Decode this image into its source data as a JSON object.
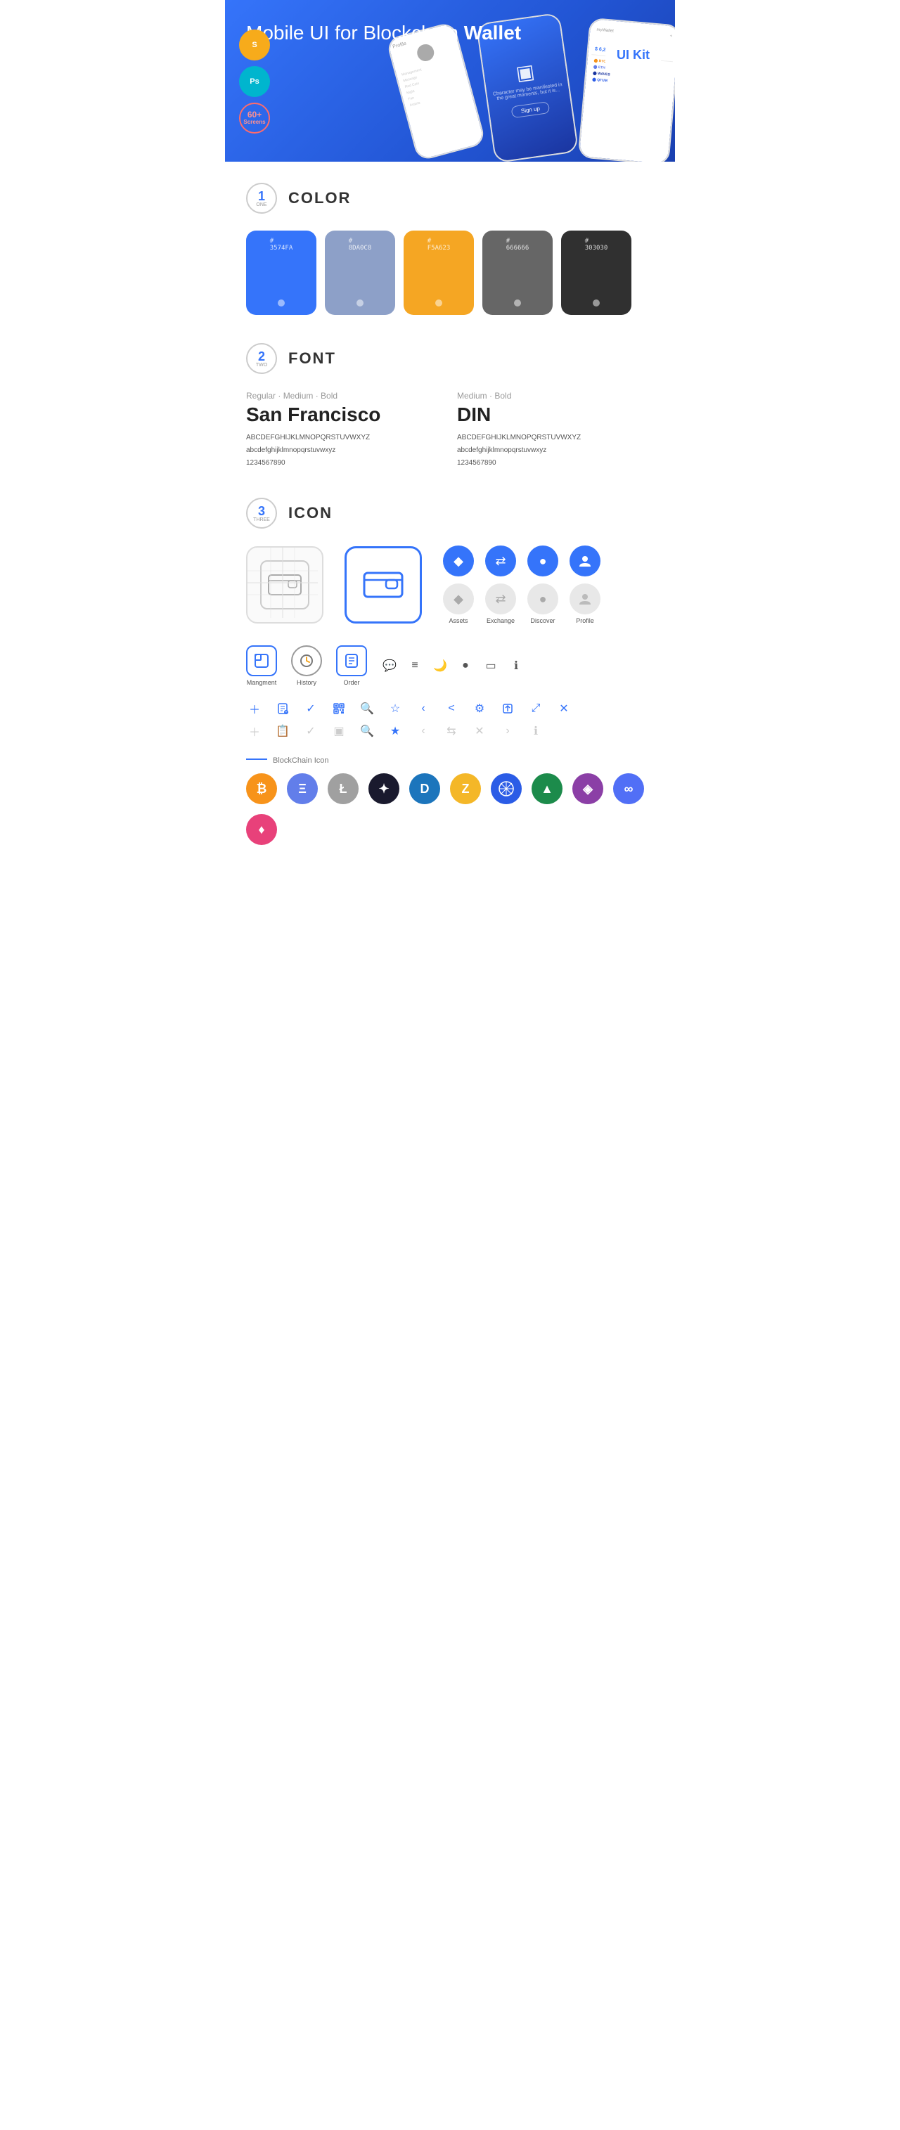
{
  "hero": {
    "title_normal": "Mobile UI for Blockchain ",
    "title_bold": "Wallet",
    "badge": "UI Kit",
    "tools": [
      {
        "name": "Sketch",
        "symbol": "S",
        "color": "#F7AB1B"
      },
      {
        "name": "Photoshop",
        "symbol": "Ps",
        "color": "#00B5CE"
      }
    ],
    "screens_badge": {
      "count": "60+",
      "label": "Screens"
    }
  },
  "sections": {
    "color": {
      "number": "1",
      "word": "ONE",
      "title": "COLOR",
      "swatches": [
        {
          "hex": "#3574FA",
          "label": "3574FA",
          "bg": "#3574FA"
        },
        {
          "hex": "#8DA0C8",
          "label": "8DA0C8",
          "bg": "#8DA0C8"
        },
        {
          "hex": "#F5A623",
          "label": "F5A623",
          "bg": "#F5A623"
        },
        {
          "hex": "#666666",
          "label": "666666",
          "bg": "#666666"
        },
        {
          "hex": "#303030",
          "label": "303030",
          "bg": "#303030"
        }
      ]
    },
    "font": {
      "number": "2",
      "word": "TWO",
      "title": "FONT",
      "fonts": [
        {
          "label": "Regular · Medium · Bold",
          "name": "San Francisco",
          "uppercase": "ABCDEFGHIJKLMNOPQRSTUVWXYZ",
          "lowercase": "abcdefghijklmnopqrstuvwxyz",
          "numbers": "1234567890"
        },
        {
          "label": "Medium · Bold",
          "name": "DIN",
          "uppercase": "ABCDEFGHIJKLMNOPQRSTUVWXYZ",
          "lowercase": "abcdefghijklmnopqrstuvwxyz",
          "numbers": "1234567890"
        }
      ]
    },
    "icon": {
      "number": "3",
      "word": "THREE",
      "title": "ICON",
      "nav_icons": [
        {
          "label": "Assets",
          "symbol": "◆"
        },
        {
          "label": "Exchange",
          "symbol": "⇄"
        },
        {
          "label": "Discover",
          "symbol": "●"
        },
        {
          "label": "Profile",
          "symbol": "👤"
        }
      ],
      "bottom_nav": [
        {
          "label": "Mangment",
          "type": "box"
        },
        {
          "label": "History",
          "type": "clock"
        },
        {
          "label": "Order",
          "type": "list"
        }
      ],
      "blockchain_label": "BlockChain Icon",
      "crypto_icons": [
        {
          "name": "Bitcoin",
          "symbol": "₿",
          "bg": "#F7931A"
        },
        {
          "name": "Ethereum",
          "symbol": "Ξ",
          "bg": "#627EEA"
        },
        {
          "name": "Litecoin",
          "symbol": "Ł",
          "bg": "#A0A0A0"
        },
        {
          "name": "Feather",
          "symbol": "✦",
          "bg": "#1A1A2E"
        },
        {
          "name": "Dash",
          "symbol": "D",
          "bg": "#1C75BC"
        },
        {
          "name": "Zcash",
          "symbol": "Z",
          "bg": "#F4B728"
        },
        {
          "name": "Quantum",
          "symbol": "◎",
          "bg": "#2B5CE6"
        },
        {
          "name": "Ardor",
          "symbol": "A",
          "bg": "#1C8B4B"
        },
        {
          "name": "Kyber",
          "symbol": "◈",
          "bg": "#31CB9E"
        },
        {
          "name": "Band",
          "symbol": "∞",
          "bg": "#516FF6"
        },
        {
          "name": "Uniswap",
          "symbol": "🦄",
          "bg": "#FF007A"
        }
      ]
    }
  }
}
